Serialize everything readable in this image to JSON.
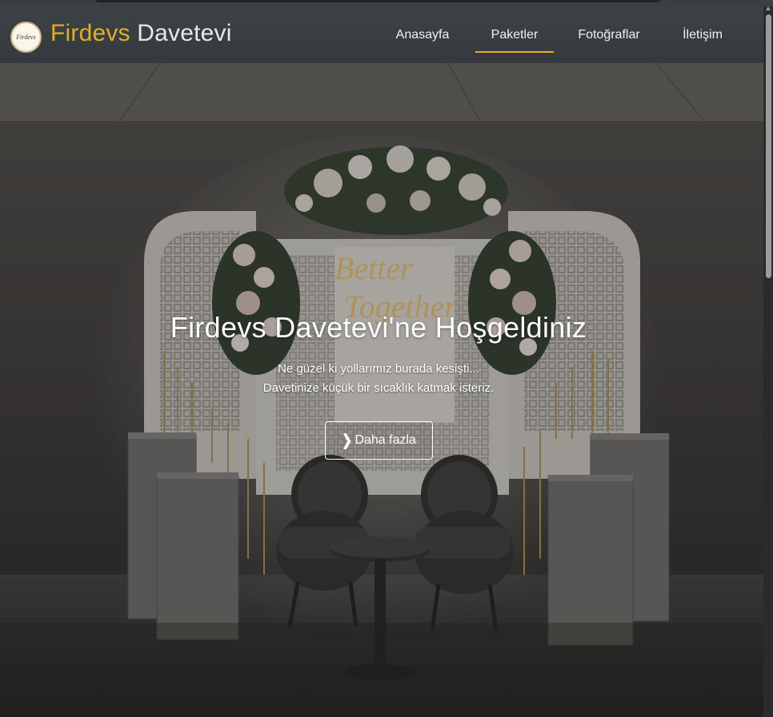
{
  "navbar": {
    "brand_part1": "Firdevs",
    "brand_part2": "Davetevi",
    "logo_text": "Firdevs",
    "links": [
      {
        "label": "Anasayfa"
      },
      {
        "label": "Paketler"
      },
      {
        "label": "Fotoğraflar"
      },
      {
        "label": "İletişim"
      }
    ],
    "active_index": 1
  },
  "hero": {
    "title": "Firdevs Davetevi'ne Hoşgeldiniz",
    "subtitle_line1": "Ne güzel ki yollarımız burada kesişti...",
    "subtitle_line2": "Davetinize küçük bir sıcaklık katmak isteriz.",
    "button_label": "Daha fazla",
    "neon_text": "Better Together"
  },
  "colors": {
    "accent": "#e6ad24",
    "navbar_bg": "#3a3f44"
  }
}
